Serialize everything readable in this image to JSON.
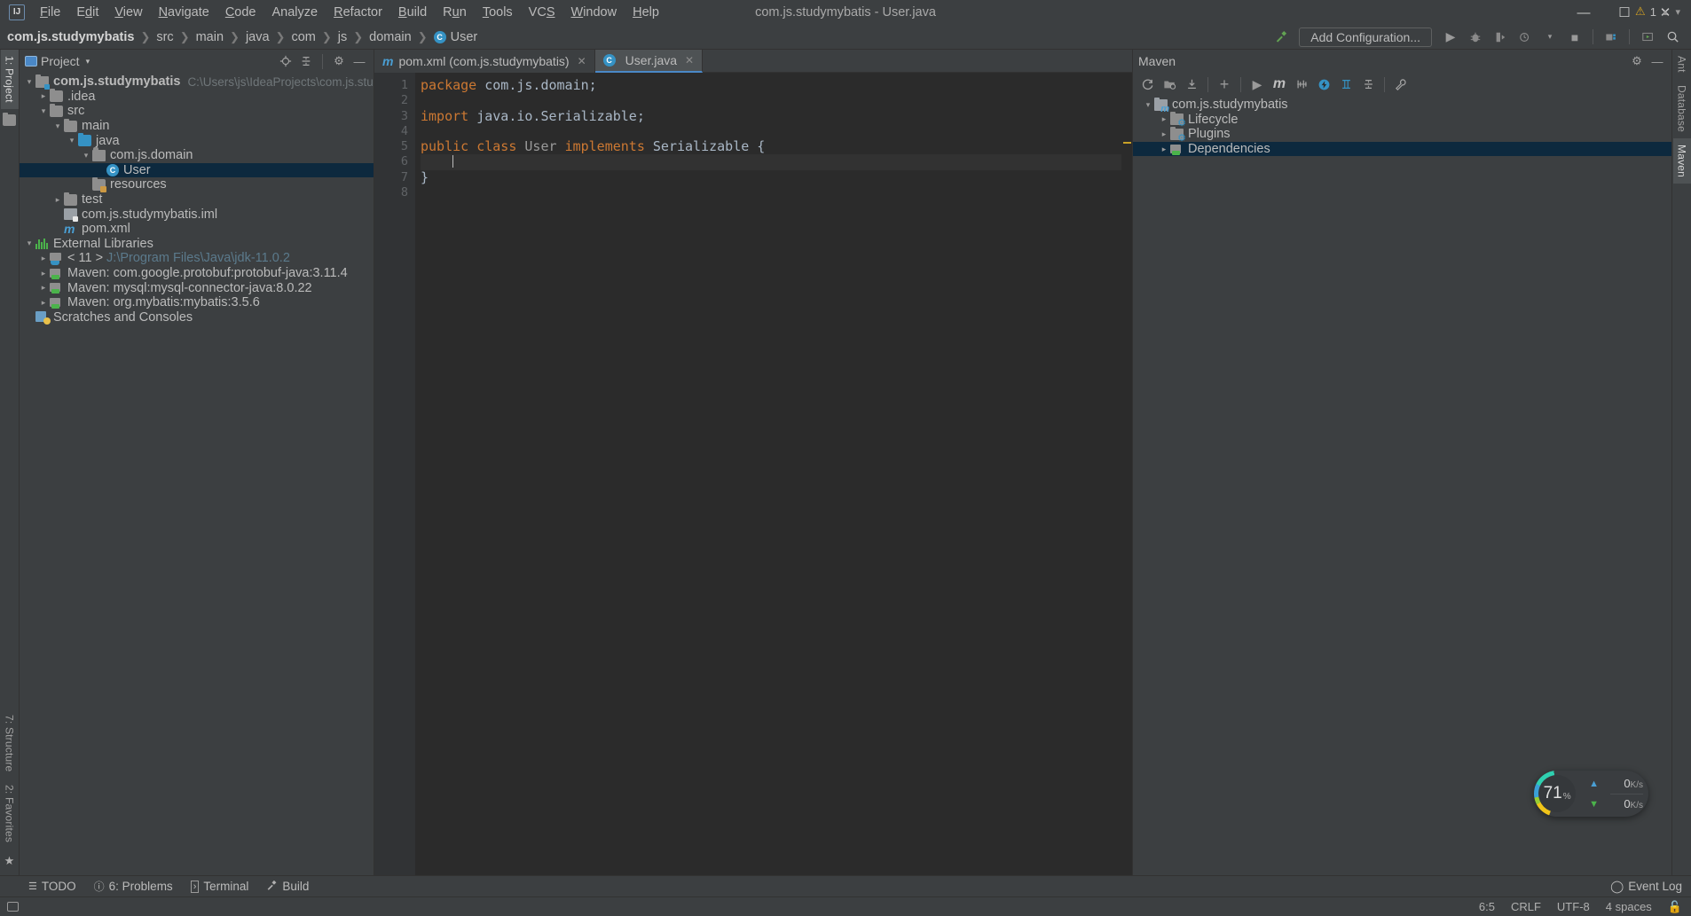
{
  "window": {
    "title": "com.js.studymybatis - User.java",
    "minimize": "—",
    "maximize": "☐",
    "close": "✕"
  },
  "menu": {
    "items": [
      "File",
      "Edit",
      "View",
      "Navigate",
      "Code",
      "Analyze",
      "Refactor",
      "Build",
      "Run",
      "Tools",
      "VCS",
      "Window",
      "Help"
    ]
  },
  "navbar": {
    "breadcrumb": [
      "com.js.studymybatis",
      "src",
      "main",
      "java",
      "com",
      "js",
      "domain",
      "User"
    ],
    "class_badge": "C",
    "add_configuration": "Add Configuration...",
    "icons": [
      "hammer-icon",
      "run-icon",
      "debug-icon",
      "run-coverage-icon",
      "profiler-icon",
      "stop-icon",
      "project-structure-icon",
      "update-icon",
      "search-icon"
    ]
  },
  "left_strip": {
    "tabs": [
      {
        "label": "1: Project",
        "active": true
      },
      {
        "label": "7: Structure",
        "active": false
      },
      {
        "label": "2: Favorites",
        "active": false
      }
    ]
  },
  "right_strip": {
    "tabs": [
      {
        "label": "Ant",
        "active": false
      },
      {
        "label": "Database",
        "active": false
      },
      {
        "label": "Maven",
        "active": true
      }
    ]
  },
  "project_panel": {
    "title": "Project",
    "toolbar": [
      "locate-icon",
      "collapse-all-icon",
      "gear-icon",
      "hide-icon"
    ],
    "tree": [
      {
        "indent": 0,
        "arrow": "open",
        "icon": "module-icon",
        "label": "com.js.studymybatis",
        "bold": true,
        "path": "C:\\Users\\js\\IdeaProjects\\com.js.studymybatis",
        "selected": false
      },
      {
        "indent": 1,
        "arrow": "closed",
        "icon": "folder-icon",
        "label": ".idea",
        "bold": false,
        "path": "",
        "selected": false
      },
      {
        "indent": 1,
        "arrow": "open",
        "icon": "folder-icon",
        "label": "src",
        "bold": false,
        "path": "",
        "selected": false
      },
      {
        "indent": 2,
        "arrow": "open",
        "icon": "folder-icon",
        "label": "main",
        "bold": false,
        "path": "",
        "selected": false
      },
      {
        "indent": 3,
        "arrow": "open",
        "icon": "source-folder-icon",
        "label": "java",
        "bold": false,
        "path": "",
        "selected": false
      },
      {
        "indent": 4,
        "arrow": "open",
        "icon": "package-icon",
        "label": "com.js.domain",
        "bold": false,
        "path": "",
        "selected": false
      },
      {
        "indent": 5,
        "arrow": "none",
        "icon": "class-icon",
        "label": "User",
        "bold": false,
        "path": "",
        "selected": true
      },
      {
        "indent": 4,
        "arrow": "none",
        "icon": "resources-folder-icon",
        "label": "resources",
        "bold": false,
        "path": "",
        "selected": false
      },
      {
        "indent": 2,
        "arrow": "closed",
        "icon": "folder-icon",
        "label": "test",
        "bold": false,
        "path": "",
        "selected": false
      },
      {
        "indent": 2,
        "arrow": "none",
        "icon": "iml-icon",
        "label": "com.js.studymybatis.iml",
        "bold": false,
        "path": "",
        "selected": false
      },
      {
        "indent": 2,
        "arrow": "none",
        "icon": "maven-icon",
        "label": "pom.xml",
        "bold": false,
        "path": "",
        "selected": false
      },
      {
        "indent": 0,
        "arrow": "open",
        "icon": "libraries-icon",
        "label": "External Libraries",
        "bold": false,
        "path": "",
        "selected": false
      },
      {
        "indent": 1,
        "arrow": "closed",
        "icon": "jdk-icon",
        "label": "< 11 >",
        "bold": false,
        "path": "J:\\Program Files\\Java\\jdk-11.0.2",
        "selected": false
      },
      {
        "indent": 1,
        "arrow": "closed",
        "icon": "jar-icon",
        "label": "Maven: com.google.protobuf:protobuf-java:3.11.4",
        "bold": false,
        "path": "",
        "selected": false
      },
      {
        "indent": 1,
        "arrow": "closed",
        "icon": "jar-icon",
        "label": "Maven: mysql:mysql-connector-java:8.0.22",
        "bold": false,
        "path": "",
        "selected": false
      },
      {
        "indent": 1,
        "arrow": "closed",
        "icon": "jar-icon",
        "label": "Maven: org.mybatis:mybatis:3.5.6",
        "bold": false,
        "path": "",
        "selected": false
      },
      {
        "indent": 0,
        "arrow": "none",
        "icon": "scratches-icon",
        "label": "Scratches and Consoles",
        "bold": false,
        "path": "",
        "selected": false
      }
    ]
  },
  "editor": {
    "tabs": [
      {
        "label": "pom.xml (com.js.studymybatis)",
        "icon": "maven-icon",
        "active": false
      },
      {
        "label": "User.java",
        "icon": "class-icon",
        "active": true
      }
    ],
    "warning_count": "1",
    "lines": [
      "1",
      "2",
      "3",
      "4",
      "5",
      "6",
      "7",
      "8"
    ],
    "code": [
      {
        "n": 1,
        "current": false,
        "tokens": [
          {
            "t": "package",
            "c": "kw"
          },
          {
            "t": " com.js.domain;",
            "c": "plain"
          }
        ]
      },
      {
        "n": 2,
        "current": false,
        "tokens": []
      },
      {
        "n": 3,
        "current": false,
        "tokens": [
          {
            "t": "import",
            "c": "kw"
          },
          {
            "t": " java.io.Serializable;",
            "c": "plain"
          }
        ]
      },
      {
        "n": 4,
        "current": false,
        "tokens": []
      },
      {
        "n": 5,
        "current": false,
        "tokens": [
          {
            "t": "public class",
            "c": "kw"
          },
          {
            "t": " ",
            "c": "plain"
          },
          {
            "t": "User",
            "c": "cdim"
          },
          {
            "t": " ",
            "c": "plain"
          },
          {
            "t": "implements",
            "c": "kw"
          },
          {
            "t": " Serializable {",
            "c": "plain"
          }
        ]
      },
      {
        "n": 6,
        "current": true,
        "tokens": [
          {
            "t": "    ",
            "c": "plain"
          }
        ]
      },
      {
        "n": 7,
        "current": false,
        "tokens": [
          {
            "t": "}",
            "c": "plain"
          }
        ]
      },
      {
        "n": 8,
        "current": false,
        "tokens": []
      }
    ]
  },
  "maven_panel": {
    "title": "Maven",
    "toolbar": [
      "reload-icon",
      "generate-sources-icon",
      "download-sources-icon",
      "add-maven-project-icon",
      "run-icon",
      "execute-goal-icon",
      "toggle-skip-tests-icon",
      "toggle-offline-icon",
      "show-dependencies-icon",
      "collapse-all-icon",
      "settings-icon"
    ],
    "gear": "gear-icon",
    "minimize": "—",
    "tree": [
      {
        "indent": 0,
        "arrow": "open",
        "icon": "maven-module-icon",
        "label": "com.js.studymybatis",
        "selected": false
      },
      {
        "indent": 1,
        "arrow": "closed",
        "icon": "lifecycle-folder-icon",
        "label": "Lifecycle",
        "selected": false
      },
      {
        "indent": 1,
        "arrow": "closed",
        "icon": "plugins-folder-icon",
        "label": "Plugins",
        "selected": false
      },
      {
        "indent": 1,
        "arrow": "closed",
        "icon": "dependencies-icon",
        "label": "Dependencies",
        "selected": true
      }
    ]
  },
  "bottom": {
    "tabs": [
      {
        "label": "TODO",
        "icon": "todo-icon",
        "mnemonic": ""
      },
      {
        "label": "6: Problems",
        "icon": "problems-icon",
        "mnemonic": "6"
      },
      {
        "label": "Terminal",
        "icon": "terminal-icon",
        "mnemonic": ""
      },
      {
        "label": "Build",
        "icon": "build-icon",
        "mnemonic": ""
      }
    ],
    "event_log": "Event Log"
  },
  "status_bar": {
    "caret_position": "6:5",
    "line_separator": "CRLF",
    "encoding": "UTF-8",
    "indent": "4 spaces",
    "lock_icon": "unlocked-icon"
  },
  "net_widget": {
    "cpu_percent": "71",
    "percent_symbol": "%",
    "upload": "0",
    "upload_unit": "K/s",
    "download": "0",
    "download_unit": "K/s"
  },
  "colors": {
    "accent_blue": "#3592c4",
    "selection": "#0d293e",
    "keyword_orange": "#cc7832",
    "editor_bg": "#2b2b2b",
    "panel_bg": "#3c3f41",
    "warning_yellow": "#d9a520"
  }
}
